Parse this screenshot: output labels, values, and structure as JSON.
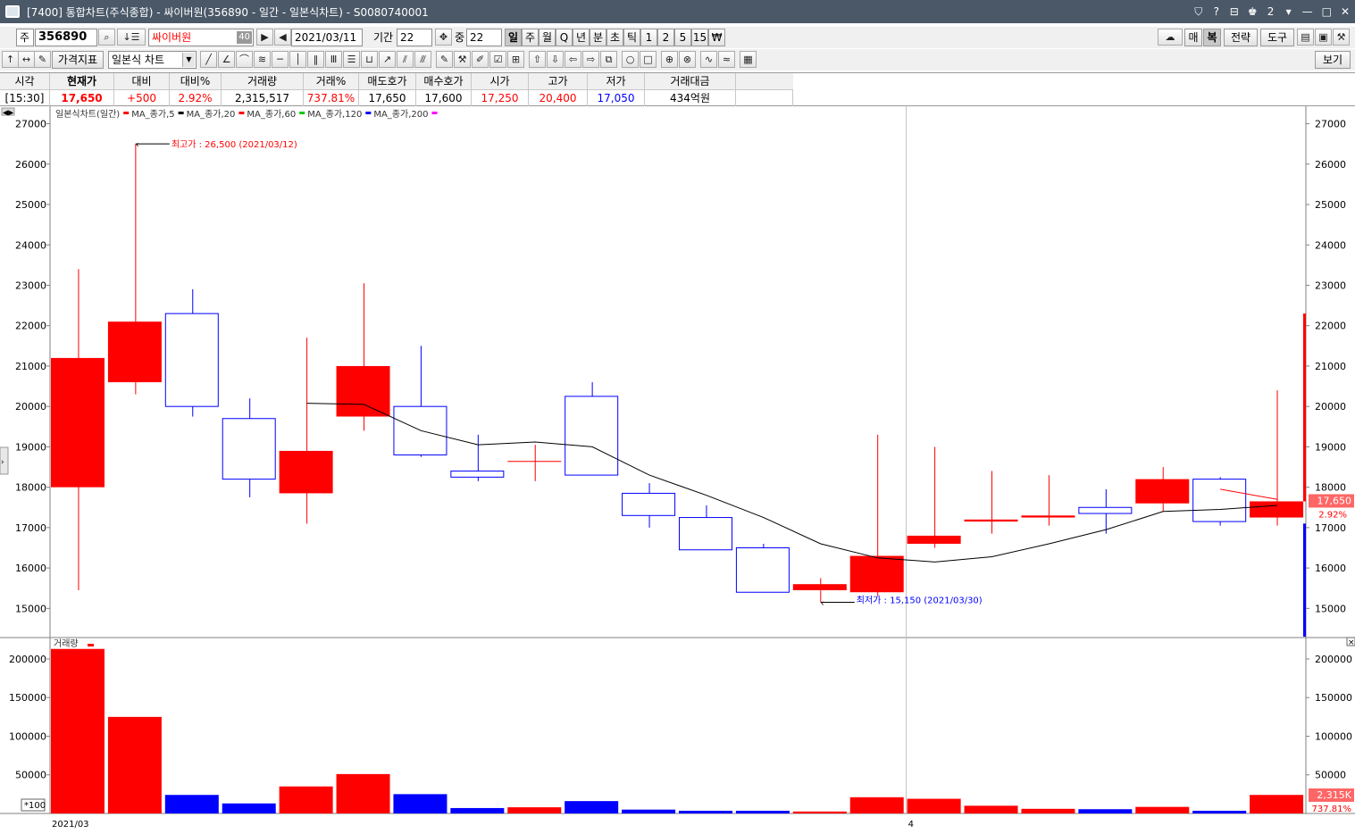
{
  "window": {
    "title": "[7400] 통합차트(주식종합) - 싸이버원(356890 - 일간 - 일본식차트) - S0080740001",
    "controls": [
      "⛉",
      "?",
      "⊟",
      "♚",
      "2",
      "▾",
      "—",
      "□",
      "✕"
    ]
  },
  "toolbar": {
    "market": "주",
    "code": "356890",
    "name": "싸이버원",
    "name_badge": "40",
    "date": "2021/03/11",
    "period_label": "기간",
    "period_value": "22",
    "overlap_label": "중",
    "overlap_value": "22",
    "intervals": [
      "일",
      "주",
      "월",
      "Q",
      "년",
      "분",
      "초",
      "틱",
      "1",
      "2",
      "5",
      "15",
      "₩"
    ],
    "selected_interval": "일",
    "right_buttons": [
      "매",
      "복",
      "전략",
      "도구"
    ],
    "indicator_label": "가격지표",
    "chart_type": "일본식 차트",
    "view_label": "보기"
  },
  "quote": {
    "headers": [
      "시각",
      "현재가",
      "대비",
      "대비%",
      "거래량",
      "거래%",
      "매도호가",
      "매수호가",
      "시가",
      "고가",
      "저가",
      "거래대금"
    ],
    "values": [
      "[15:30]",
      "17,650",
      "+500",
      "2.92%",
      "2,315,517",
      "737.81%",
      "17,650",
      "17,600",
      "17,250",
      "20,400",
      "17,050",
      "434억원"
    ],
    "value_colors": [
      "#000000",
      "#ff0000",
      "#ff0000",
      "#ff0000",
      "#000000",
      "#ff0000",
      "#000000",
      "#000000",
      "#ff0000",
      "#ff0000",
      "#0000ff",
      "#000000"
    ]
  },
  "chart_data": {
    "type": "candlestick",
    "legend_text": "일본식차트(일간)",
    "ma_legend": [
      {
        "name": "MA_종가,5",
        "color": "#ff0000"
      },
      {
        "name": "MA_종가,20",
        "color": "#000000"
      },
      {
        "name": "MA_종가,60",
        "color": "#ff0000"
      },
      {
        "name": "MA_종가,120",
        "color": "#00cc00"
      },
      {
        "name": "MA_종가,200",
        "color": "#0000ff"
      }
    ],
    "ma_end_color": "#ff00ff",
    "up_color": "#ff0000",
    "down_color": "#0000ff",
    "price_ylim": [
      14300,
      27300
    ],
    "price_ticks": [
      15000,
      16000,
      17000,
      18000,
      19000,
      20000,
      21000,
      22000,
      23000,
      24000,
      25000,
      26000,
      27000
    ],
    "candles": [
      {
        "o": 18000,
        "h": 23400,
        "l": 15450,
        "c": 21200
      },
      {
        "o": 20600,
        "h": 26500,
        "l": 20300,
        "c": 22100
      },
      {
        "o": 22300,
        "h": 22900,
        "l": 19750,
        "c": 20000
      },
      {
        "o": 19700,
        "h": 20200,
        "l": 17750,
        "c": 18200
      },
      {
        "o": 17850,
        "h": 21700,
        "l": 17100,
        "c": 18900
      },
      {
        "o": 19750,
        "h": 23050,
        "l": 19400,
        "c": 21000
      },
      {
        "o": 20000,
        "h": 21500,
        "l": 18750,
        "c": 18800
      },
      {
        "o": 18400,
        "h": 19300,
        "l": 18150,
        "c": 18250
      },
      {
        "o": 18650,
        "h": 19050,
        "l": 18150,
        "c": 18650
      },
      {
        "o": 20250,
        "h": 20600,
        "l": 18300,
        "c": 18300
      },
      {
        "o": 17850,
        "h": 18100,
        "l": 17000,
        "c": 17300
      },
      {
        "o": 17250,
        "h": 17550,
        "l": 16450,
        "c": 16450
      },
      {
        "o": 16500,
        "h": 16600,
        "l": 15400,
        "c": 15400
      },
      {
        "o": 15450,
        "h": 15750,
        "l": 15150,
        "c": 15600
      },
      {
        "o": 15400,
        "h": 19300,
        "l": 15300,
        "c": 16300
      },
      {
        "o": 16600,
        "h": 19000,
        "l": 16500,
        "c": 16800
      },
      {
        "o": 17150,
        "h": 18400,
        "l": 16850,
        "c": 17200
      },
      {
        "o": 17250,
        "h": 18300,
        "l": 17050,
        "c": 17300
      },
      {
        "o": 17500,
        "h": 17950,
        "l": 16850,
        "c": 17350
      },
      {
        "o": 17600,
        "h": 18500,
        "l": 17400,
        "c": 18200
      },
      {
        "o": 18200,
        "h": 18250,
        "l": 17050,
        "c": 17150
      },
      {
        "o": 17250,
        "h": 20400,
        "l": 17050,
        "c": 17650
      }
    ],
    "ma20": [
      null,
      null,
      null,
      null,
      20080,
      20050,
      19400,
      19050,
      19120,
      19000,
      18300,
      17800,
      17250,
      16600,
      16250,
      16150,
      16280,
      16600,
      16950,
      17400,
      17450,
      17550
    ],
    "annotations": {
      "high_text": "최고가 : 26,500 (2021/03/12)",
      "high_value": 26500,
      "high_index": 1,
      "low_text": "최저가 : 15,150 (2021/03/30)",
      "low_value": 15150,
      "low_index": 13
    },
    "current_price_label": "17,650",
    "current_change_label": "2.92%",
    "current_price": 17650,
    "side_range_red": [
      17650,
      22300
    ],
    "side_range_blue": [
      14300,
      17100
    ],
    "volume_title": "거래량",
    "volume_ylim": [
      0,
      215000
    ],
    "volume_ticks": [
      50000,
      100000,
      150000,
      200000
    ],
    "volumes": [
      213000,
      125000,
      24000,
      13000,
      35000,
      51000,
      25000,
      7000,
      8000,
      16000,
      5000,
      3500,
      3500,
      2500,
      21000,
      19000,
      10000,
      6000,
      5500,
      8500,
      3500,
      24000
    ],
    "volume_scale_label": "*100",
    "volume_current_label": "2,315K",
    "volume_pct_label": "737.81%",
    "volume_current": 23155,
    "x_labels": [
      {
        "index": 0,
        "text": "2021/03"
      },
      {
        "index": 15,
        "text": "4"
      }
    ],
    "vline_index": 15,
    "close_icon": "×"
  }
}
